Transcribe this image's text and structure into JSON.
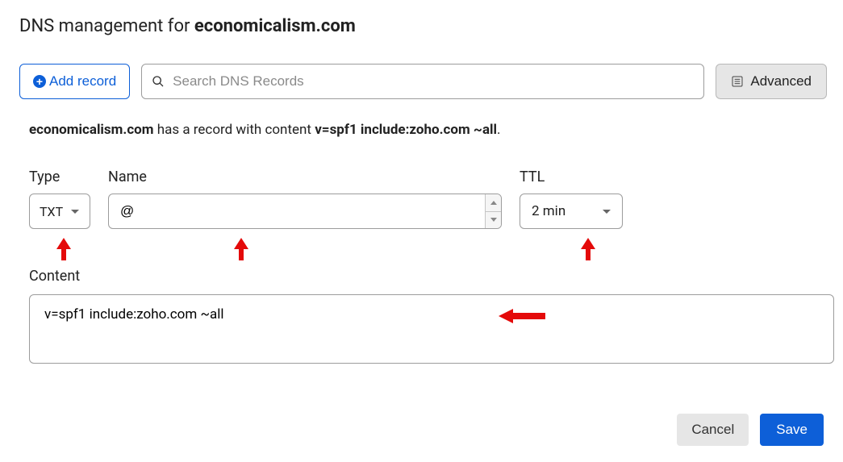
{
  "header": {
    "title_prefix": "DNS management for ",
    "domain": "economicalism.com"
  },
  "toolbar": {
    "add_record_label": "Add record",
    "search_placeholder": "Search DNS Records",
    "advanced_label": "Advanced"
  },
  "notice": {
    "domain": "economicalism.com",
    "mid_text": " has a record with content ",
    "content_value": "v=spf1 include:zoho.com ~all",
    "suffix": "."
  },
  "form": {
    "type_label": "Type",
    "type_value": "TXT",
    "name_label": "Name",
    "name_value": "@",
    "ttl_label": "TTL",
    "ttl_value": "2 min",
    "content_label": "Content",
    "content_value": "v=spf1 include:zoho.com ~all"
  },
  "footer": {
    "cancel_label": "Cancel",
    "save_label": "Save"
  }
}
